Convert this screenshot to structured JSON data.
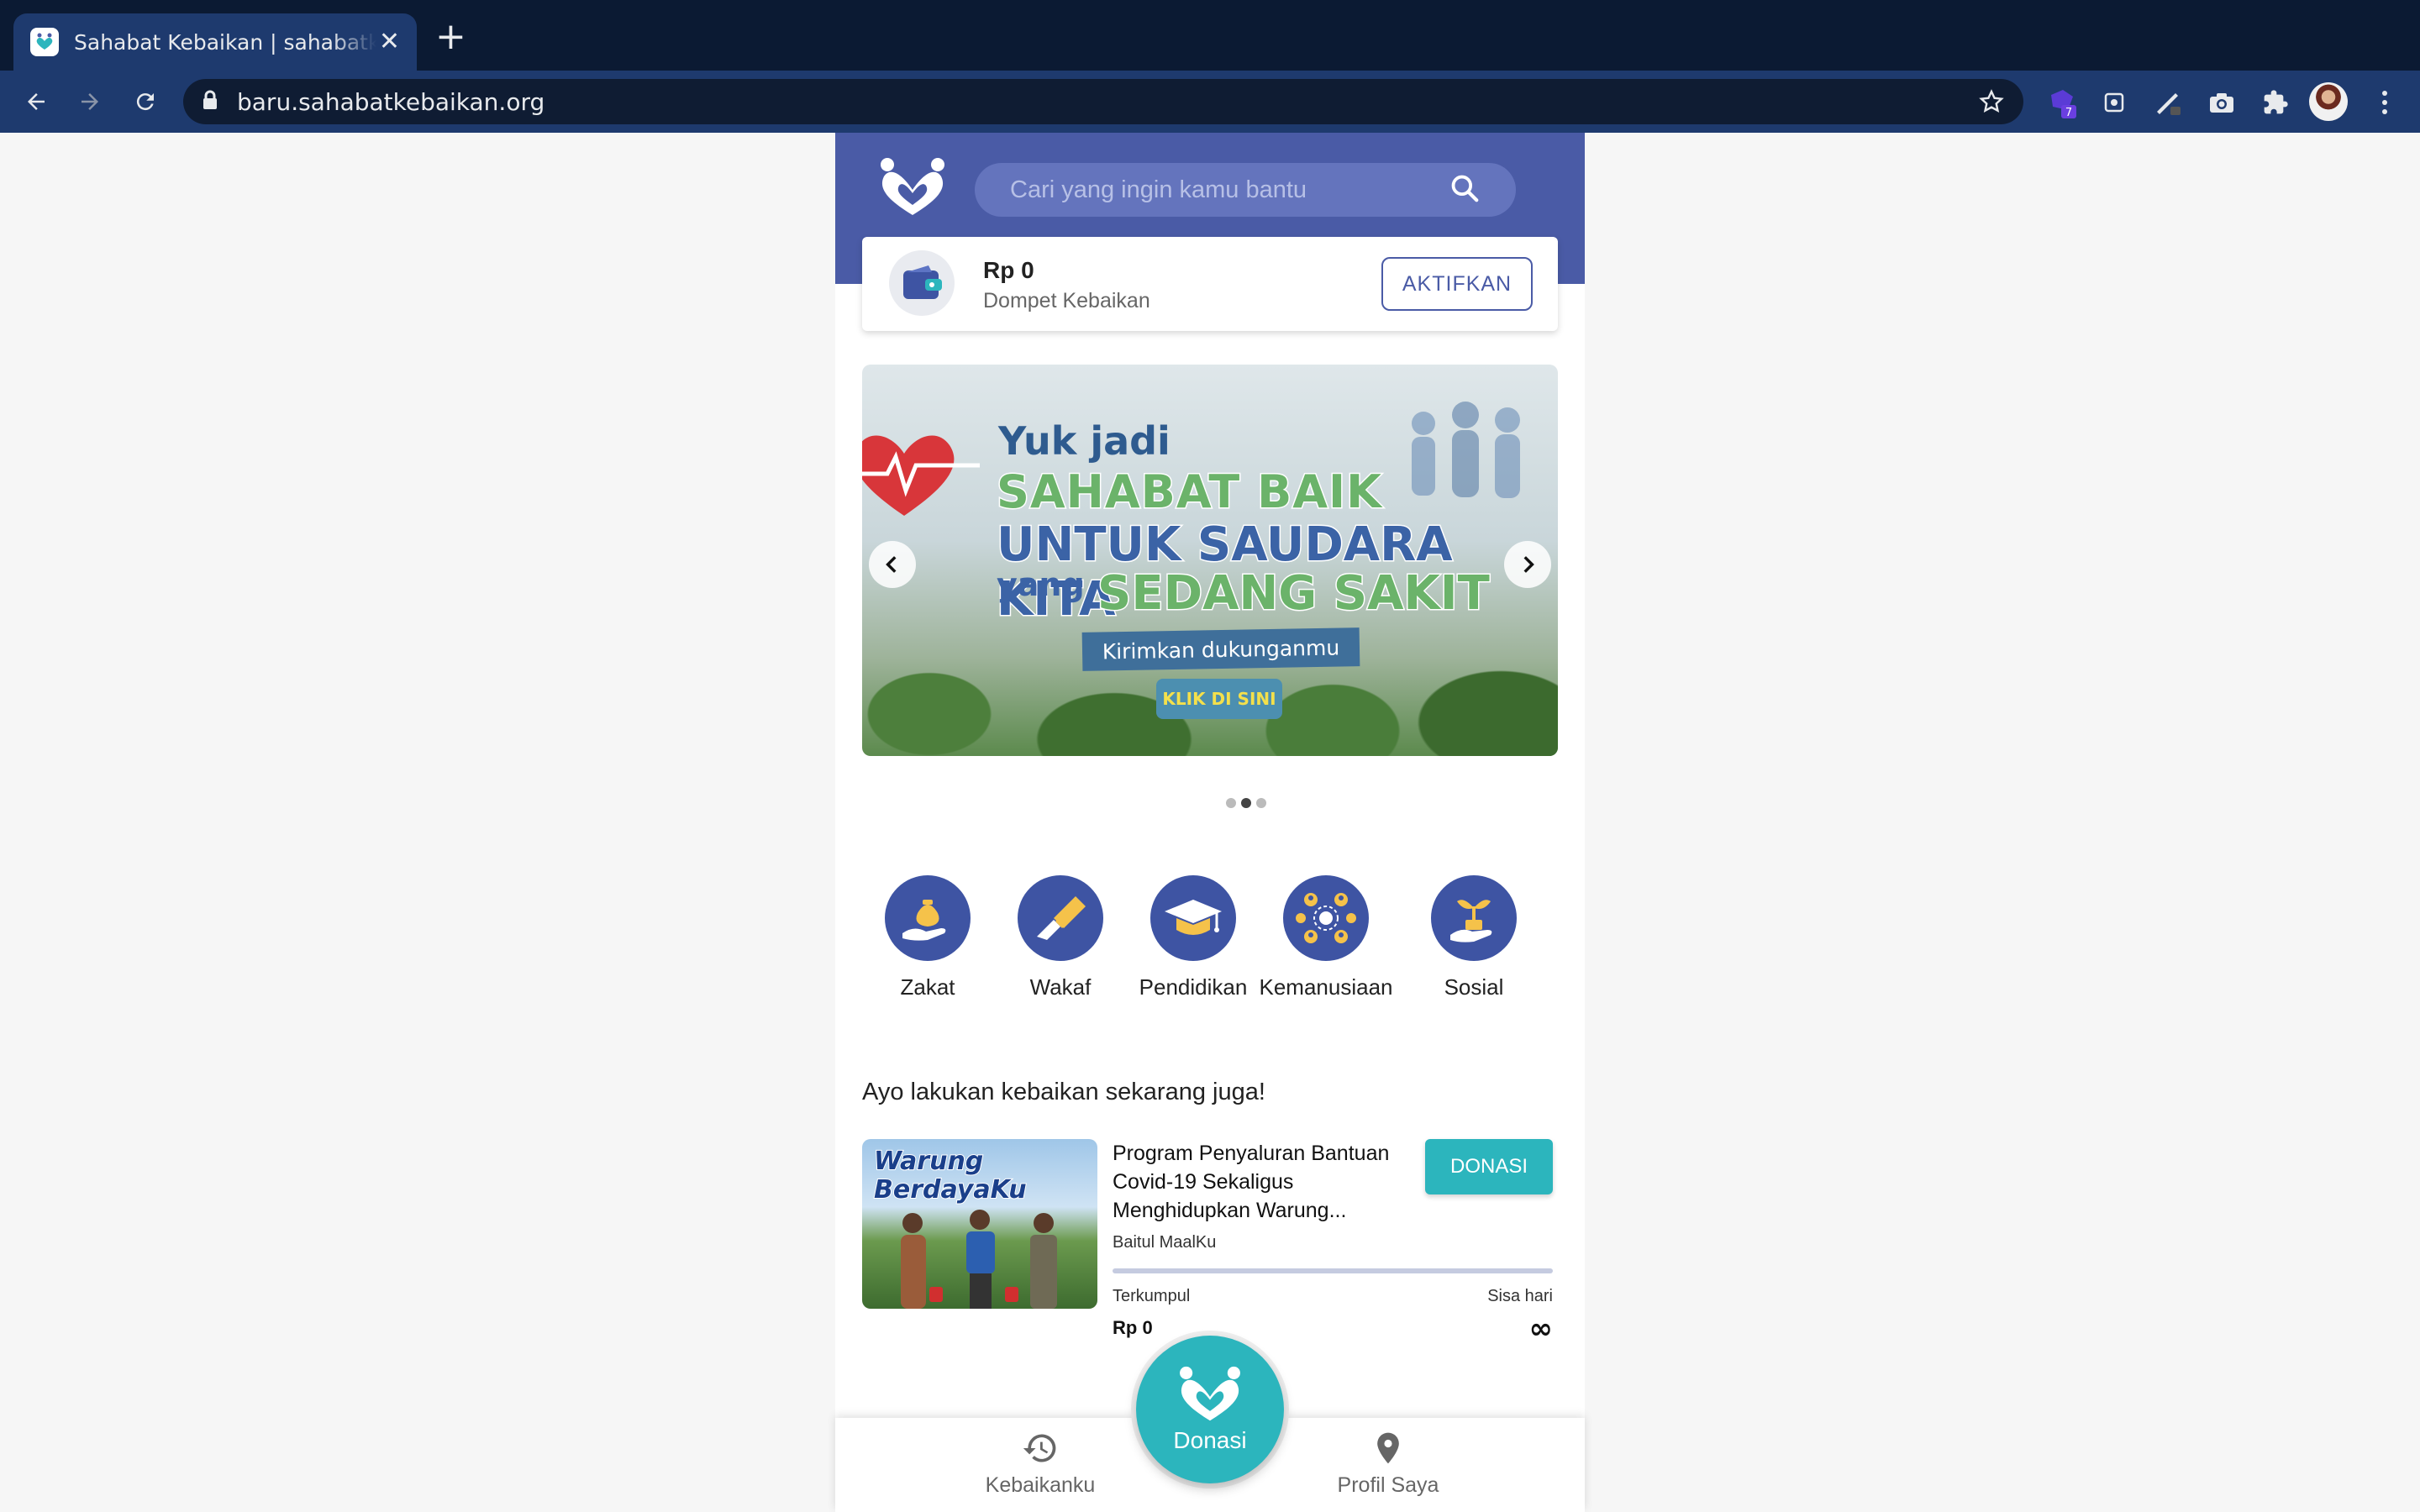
{
  "browser": {
    "tab_title": "Sahabat Kebaikan | sahabatkebaikan",
    "url": "baru.sahabatkebaikan.org",
    "extension_badge": "7"
  },
  "header": {
    "search_placeholder": "Cari yang ingin kamu bantu"
  },
  "wallet": {
    "amount": "Rp 0",
    "label": "Dompet Kebaikan",
    "activate_label": "AKTIFKAN"
  },
  "banner": {
    "line1": "Yuk jadi",
    "line2": "SAHABAT BAIK",
    "line3": "UNTUK SAUDARA KITA",
    "line4a": "yang",
    "line4b": "SEDANG SAKIT",
    "subtitle": "Kirimkan dukunganmu",
    "cta": "KLIK DI SINI",
    "slide_count": 3,
    "active_slide": 2
  },
  "categories": [
    {
      "label": "Zakat",
      "icon": "hand-money-bag-icon"
    },
    {
      "label": "Wakaf",
      "icon": "giving-hands-icon"
    },
    {
      "label": "Pendidikan",
      "icon": "graduation-cap-icon"
    },
    {
      "label": "Kemanusiaan",
      "icon": "people-network-icon"
    },
    {
      "label": "Sosial",
      "icon": "plant-in-hand-icon"
    }
  ],
  "campaigns": {
    "title": "Ayo lakukan kebaikan sekarang juga!",
    "items": [
      {
        "image_title_1": "Warung",
        "image_title_2": "BerdayaKu",
        "title": "Program Penyaluran Bantuan Covid-19 Sekaligus Menghidupkan Warung...",
        "organization": "Baitul MaalKu",
        "donate_label": "DONASI",
        "collected_label": "Terkumpul",
        "collected_value": "Rp 0",
        "remaining_label": "Sisa hari",
        "remaining_value": "∞",
        "progress": 0
      }
    ]
  },
  "bottom_nav": {
    "left_label": "Kebaikanku",
    "center_label": "Donasi",
    "right_label": "Profil Saya"
  },
  "colors": {
    "primary": "#4a5ba6",
    "teal": "#2cb5bd",
    "browser_frame": "#0b1a33",
    "browser_toolbar": "#1e3a6e"
  }
}
